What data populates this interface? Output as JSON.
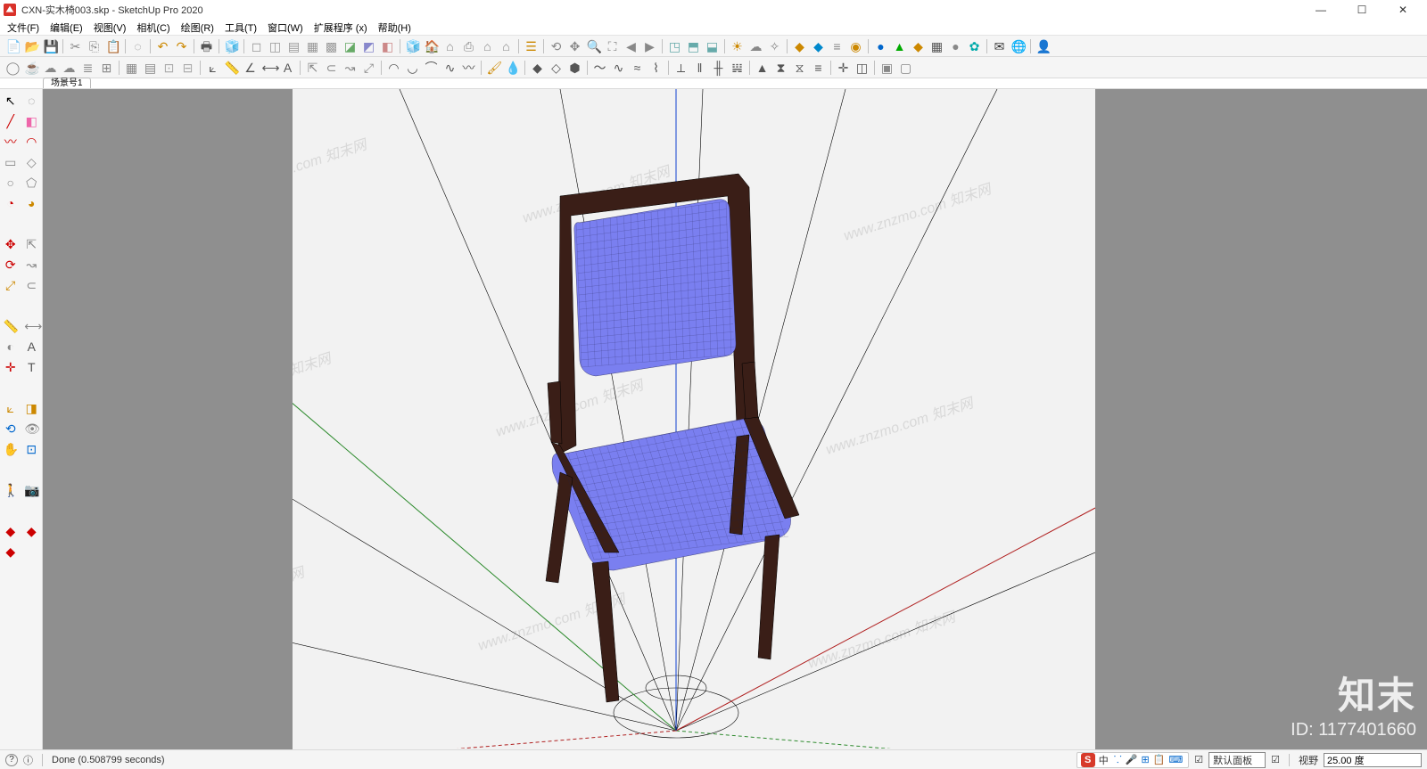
{
  "title": "CXN-实木椅003.skp - SketchUp Pro 2020",
  "window_buttons": {
    "min": "—",
    "max": "☐",
    "close": "✕"
  },
  "menus": [
    "文件(F)",
    "编辑(E)",
    "视图(V)",
    "相机(C)",
    "绘图(R)",
    "工具(T)",
    "窗口(W)",
    "扩展程序 (x)",
    "帮助(H)"
  ],
  "toolbar_row1": [
    {
      "n": "new-file",
      "g": "📄",
      "c": "#c44"
    },
    {
      "n": "open-file",
      "g": "📂",
      "c": "#c80"
    },
    {
      "n": "save-file",
      "g": "💾",
      "c": "#36c"
    },
    {
      "n": "sep"
    },
    {
      "n": "cut",
      "g": "✂",
      "c": "#888"
    },
    {
      "n": "copy",
      "g": "⎘",
      "c": "#888"
    },
    {
      "n": "paste",
      "g": "📋",
      "c": "#888"
    },
    {
      "n": "sep"
    },
    {
      "n": "erase",
      "g": "◌",
      "c": "#888"
    },
    {
      "n": "sep"
    },
    {
      "n": "undo",
      "g": "↶",
      "c": "#c80"
    },
    {
      "n": "redo",
      "g": "↷",
      "c": "#c80"
    },
    {
      "n": "sep"
    },
    {
      "n": "print",
      "g": "🖶",
      "c": "#555"
    },
    {
      "n": "sep"
    },
    {
      "n": "model-info",
      "g": "🧊",
      "c": "#c44"
    },
    {
      "n": "sep"
    },
    {
      "n": "face-style-1",
      "g": "◻",
      "c": "#999"
    },
    {
      "n": "face-style-2",
      "g": "◫",
      "c": "#999"
    },
    {
      "n": "face-style-3",
      "g": "▤",
      "c": "#999"
    },
    {
      "n": "face-style-4",
      "g": "▦",
      "c": "#999"
    },
    {
      "n": "face-style-5",
      "g": "▩",
      "c": "#999"
    },
    {
      "n": "face-style-6",
      "g": "◪",
      "c": "#6a6"
    },
    {
      "n": "face-style-7",
      "g": "◩",
      "c": "#88c"
    },
    {
      "n": "face-style-8",
      "g": "◧",
      "c": "#c88"
    },
    {
      "n": "sep"
    },
    {
      "n": "component-1",
      "g": "🧊",
      "c": "#888"
    },
    {
      "n": "component-2",
      "g": "🏠",
      "c": "#888"
    },
    {
      "n": "component-3",
      "g": "⌂",
      "c": "#888"
    },
    {
      "n": "component-4",
      "g": "⎙",
      "c": "#888"
    },
    {
      "n": "component-5",
      "g": "⌂",
      "c": "#888"
    },
    {
      "n": "component-6",
      "g": "⌂",
      "c": "#888"
    },
    {
      "n": "sep"
    },
    {
      "n": "layers",
      "g": "☰",
      "c": "#c80"
    },
    {
      "n": "sep"
    },
    {
      "n": "orbit-cam",
      "g": "⟲",
      "c": "#888"
    },
    {
      "n": "pan-cam",
      "g": "✥",
      "c": "#888"
    },
    {
      "n": "zoom-cam",
      "g": "🔍",
      "c": "#888"
    },
    {
      "n": "zoom-ext",
      "g": "⛶",
      "c": "#888"
    },
    {
      "n": "prev-view",
      "g": "◀",
      "c": "#888"
    },
    {
      "n": "next-view",
      "g": "▶",
      "c": "#888"
    },
    {
      "n": "sep"
    },
    {
      "n": "iso-view",
      "g": "◳",
      "c": "#6aa"
    },
    {
      "n": "top-view",
      "g": "⬒",
      "c": "#6aa"
    },
    {
      "n": "front-view",
      "g": "⬓",
      "c": "#6aa"
    },
    {
      "n": "sep"
    },
    {
      "n": "shadow",
      "g": "☀",
      "c": "#c80"
    },
    {
      "n": "fog",
      "g": "☁",
      "c": "#888"
    },
    {
      "n": "xray",
      "g": "✧",
      "c": "#888"
    },
    {
      "n": "sep"
    },
    {
      "n": "plugin-a",
      "g": "◆",
      "c": "#c80"
    },
    {
      "n": "plugin-b",
      "g": "◆",
      "c": "#08c"
    },
    {
      "n": "plugin-c",
      "g": "≡",
      "c": "#888"
    },
    {
      "n": "plugin-d",
      "g": "◉",
      "c": "#c80"
    },
    {
      "n": "sep"
    },
    {
      "n": "ext-1",
      "g": "●",
      "c": "#06c"
    },
    {
      "n": "ext-2",
      "g": "▲",
      "c": "#0a0"
    },
    {
      "n": "ext-3",
      "g": "◆",
      "c": "#c80"
    },
    {
      "n": "ext-4",
      "g": "▦",
      "c": "#555"
    },
    {
      "n": "ext-5",
      "g": "●",
      "c": "#888"
    },
    {
      "n": "ext-6",
      "g": "✿",
      "c": "#0aa"
    },
    {
      "n": "sep"
    },
    {
      "n": "mail",
      "g": "✉",
      "c": "#333"
    },
    {
      "n": "geo",
      "g": "🌐",
      "c": "#06c"
    },
    {
      "n": "sep"
    },
    {
      "n": "user",
      "g": "👤",
      "c": "#333"
    }
  ],
  "toolbar_row2": [
    {
      "n": "circle-tool",
      "g": "◯",
      "c": "#888"
    },
    {
      "n": "teapot",
      "g": "☕",
      "c": "#888"
    },
    {
      "n": "cloud-a",
      "g": "☁",
      "c": "#888"
    },
    {
      "n": "cloud-b",
      "g": "☁",
      "c": "#888"
    },
    {
      "n": "layer-a",
      "g": "≣",
      "c": "#888"
    },
    {
      "n": "layer-b",
      "g": "⊞",
      "c": "#888"
    },
    {
      "n": "sep"
    },
    {
      "n": "grid-a",
      "g": "▦",
      "c": "#888"
    },
    {
      "n": "grid-b",
      "g": "▤",
      "c": "#888"
    },
    {
      "n": "grid-c",
      "g": "⊡",
      "c": "#aaa"
    },
    {
      "n": "grid-d",
      "g": "⊟",
      "c": "#aaa"
    },
    {
      "n": "sep"
    },
    {
      "n": "section",
      "g": "⟀",
      "c": "#555"
    },
    {
      "n": "tape",
      "g": "📏",
      "c": "#888"
    },
    {
      "n": "angle",
      "g": "∠",
      "c": "#555"
    },
    {
      "n": "dim",
      "g": "⟷",
      "c": "#555"
    },
    {
      "n": "text",
      "g": "A",
      "c": "#555"
    },
    {
      "n": "sep"
    },
    {
      "n": "pushpull-2",
      "g": "⇱",
      "c": "#888"
    },
    {
      "n": "offset-2",
      "g": "⊂",
      "c": "#888"
    },
    {
      "n": "followme",
      "g": "↝",
      "c": "#888"
    },
    {
      "n": "scale-2",
      "g": "⤢",
      "c": "#888"
    },
    {
      "n": "sep"
    },
    {
      "n": "arc-a",
      "g": "◠",
      "c": "#555"
    },
    {
      "n": "arc-b",
      "g": "◡",
      "c": "#555"
    },
    {
      "n": "arc-c",
      "g": "⌒",
      "c": "#555"
    },
    {
      "n": "bezier",
      "g": "∿",
      "c": "#555"
    },
    {
      "n": "freehand-2",
      "g": "〰",
      "c": "#555"
    },
    {
      "n": "sep"
    },
    {
      "n": "paintb",
      "g": "🖌",
      "c": "#c80"
    },
    {
      "n": "eyedrop",
      "g": "💧",
      "c": "#888"
    },
    {
      "n": "sep"
    },
    {
      "n": "solid-1",
      "g": "◆",
      "c": "#555"
    },
    {
      "n": "solid-2",
      "g": "◇",
      "c": "#555"
    },
    {
      "n": "solid-3",
      "g": "⬢",
      "c": "#555"
    },
    {
      "n": "sep"
    },
    {
      "n": "curve-1",
      "g": "〜",
      "c": "#555"
    },
    {
      "n": "curve-2",
      "g": "∿",
      "c": "#555"
    },
    {
      "n": "curve-3",
      "g": "≈",
      "c": "#555"
    },
    {
      "n": "curve-4",
      "g": "⌇",
      "c": "#555"
    },
    {
      "n": "sep"
    },
    {
      "n": "guide-1",
      "g": "⟂",
      "c": "#555"
    },
    {
      "n": "guide-2",
      "g": "‖",
      "c": "#555"
    },
    {
      "n": "guide-3",
      "g": "╫",
      "c": "#555"
    },
    {
      "n": "column",
      "g": "𝍏",
      "c": "#555"
    },
    {
      "n": "sep"
    },
    {
      "n": "mirror",
      "g": "▲",
      "c": "#555"
    },
    {
      "n": "flip-v",
      "g": "⧗",
      "c": "#555"
    },
    {
      "n": "flip-h",
      "g": "⧖",
      "c": "#555"
    },
    {
      "n": "align",
      "g": "≡",
      "c": "#555"
    },
    {
      "n": "sep"
    },
    {
      "n": "axis-t",
      "g": "✛",
      "c": "#555"
    },
    {
      "n": "cplane",
      "g": "◫",
      "c": "#555"
    },
    {
      "n": "sep"
    },
    {
      "n": "reg-a",
      "g": "▣",
      "c": "#888"
    },
    {
      "n": "reg-b",
      "g": "▢",
      "c": "#888"
    }
  ],
  "left_tools": [
    [
      "select-tool",
      "↖",
      "#000",
      "lasso-tool",
      "◌",
      "#888"
    ],
    [
      "line-tool",
      "╱",
      "#c00",
      "eraser-tool",
      "◧",
      "#e6a"
    ],
    [
      "freehand-tool",
      "〰",
      "#c00",
      "arc-tool",
      "◠",
      "#c00"
    ],
    [
      "rectangle-tool",
      "▭",
      "#888",
      "rot-rect-tool",
      "◇",
      "#888"
    ],
    [
      "circle-tool",
      "○",
      "#888",
      "polygon-tool",
      "⬠",
      "#888"
    ],
    [
      "pie-tool",
      "◔",
      "#c00",
      "pie2-tool",
      "◕",
      "#c80"
    ],
    [
      "",
      "",
      "",
      ""
    ],
    [
      "move-tool",
      "✥",
      "#c00",
      "pushpull-tool",
      "⇱",
      "#888"
    ],
    [
      "rotate-tool",
      "⟳",
      "#c00",
      "followme-tool",
      "↝",
      "#888"
    ],
    [
      "scale-tool",
      "⤢",
      "#c80",
      "offset-tool",
      "⊂",
      "#888"
    ],
    [
      "",
      "",
      "",
      ""
    ],
    [
      "tape-tool",
      "📏",
      "#888",
      "dim-tool",
      "⟷",
      "#888"
    ],
    [
      "protractor",
      "◐",
      "#888",
      "text-tool",
      "A",
      "#555"
    ],
    [
      "axis-tool",
      "✛",
      "#c00",
      "3dtext",
      "T",
      "#555"
    ],
    [
      "",
      "",
      "",
      ""
    ],
    [
      "section-tool",
      "⟀",
      "#c80",
      "section-fill",
      "◨",
      "#c80"
    ],
    [
      "orbit-tool",
      "⟲",
      "#06c",
      "look-tool",
      "👁",
      "#888"
    ],
    [
      "pan-tool",
      "✋",
      "#c80",
      "zoomwin",
      "⊡",
      "#06c"
    ],
    [
      "",
      "",
      "",
      ""
    ],
    [
      "walk-tool",
      "🚶",
      "#555",
      "position-cam",
      "📷",
      "#555"
    ],
    [
      "",
      "",
      "",
      ""
    ],
    [
      "plugin-red-1",
      "◆",
      "#c00",
      "plugin-red-2",
      "◆",
      "#c00"
    ],
    [
      "plugin-red-3",
      "◆",
      "#c00",
      "",
      ""
    ]
  ],
  "scene_tab": "场景号1",
  "status": {
    "help_icon": "?",
    "info_icon": "ⓘ",
    "message": "Done (0.508799 seconds)",
    "ime_s": "S",
    "ime_lang": "中",
    "ime_icons": [
      "⸪",
      "🎤",
      "⊞",
      "📋",
      "⌨"
    ],
    "tray_label": "默认面板",
    "tray_toggle": "☑",
    "vcb_label": "视野",
    "vcb_value": "25.00 度"
  },
  "watermark": {
    "repeat_text": "www.znzmo.com  知末网",
    "brand": "知末",
    "id_label": "ID: 1177401660"
  }
}
